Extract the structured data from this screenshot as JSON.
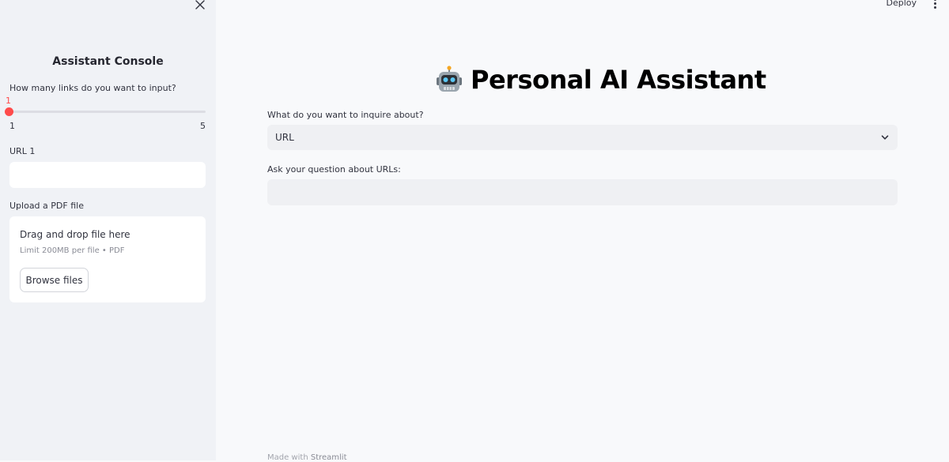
{
  "sidebar": {
    "title": "Assistant Console",
    "links_label": "How many links do you want to input?",
    "slider": {
      "value": "1",
      "min": "1",
      "max": "5",
      "value_fraction": 0,
      "accent": "#ff4b4b"
    },
    "url_label": "URL 1",
    "url_value": "",
    "upload_label": "Upload a PDF file",
    "dropzone": {
      "title": "Drag and drop file here",
      "limit": "Limit 200MB per file • PDF",
      "button": "Browse files"
    }
  },
  "header": {
    "deploy": "Deploy"
  },
  "main": {
    "title_icon": "robot-icon",
    "title": "Personal AI Assistant",
    "inquire_label": "What do you want to inquire about?",
    "inquire_selected": "URL",
    "question_label": "Ask your question about URLs:",
    "question_value": ""
  },
  "footer": {
    "made_with": "Made with",
    "brand": "Streamlit"
  }
}
